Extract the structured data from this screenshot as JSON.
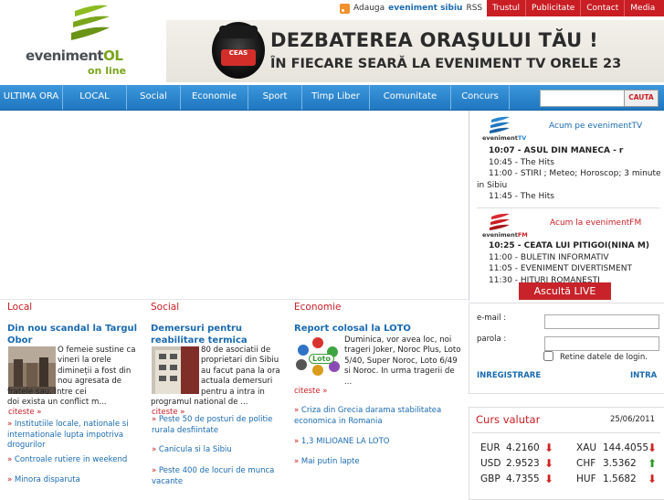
{
  "header": {
    "logo_word_a": "eveniment",
    "logo_word_b": "OL",
    "logo_sub": "on line",
    "rss_prefix": "Adauga",
    "rss_site": "eveniment sibiu",
    "rss_suffix": "RSS",
    "top_menu": [
      "Trustul",
      "Publicitate",
      "Contact",
      "Media"
    ],
    "banner_line1": "DEZBATEREA ORAŞULUI TĂU !",
    "banner_line2": "ÎN FIECARE SEARĂ LA EVENIMENT TV ORELE 23",
    "banner_badge": "CEAS"
  },
  "nav": {
    "items": [
      "ULTIMA ORA",
      "LOCAL",
      "Social",
      "Economie",
      "Sport",
      "Timp Liber",
      "Comunitate",
      "Concurs"
    ],
    "search_button": "CAUTA",
    "search_placeholder": ""
  },
  "tv": {
    "logo_a": "eveniment",
    "logo_b": "TV",
    "heading": "Acum pe evenimentTV",
    "now": "10:07 - ASUL DIN MANECA - r",
    "items": [
      "10:45 - The Hits",
      "11:00 - STIRI ; Meteo; Horoscop; 3 minute",
      "in Sibiu",
      "11:45 - The Hits"
    ]
  },
  "fm": {
    "logo_a": "eveniment",
    "logo_b": "FM",
    "heading": "Acum la evenimentFM",
    "now": "10:25 - CEATA LUI PITIGOI(NINA M)",
    "items": [
      "11:00 - BULETIN INFORMATIV",
      "11:05 - EVENIMENT DIVERTISMENT",
      "11:30 - HITURI ROMANESTI"
    ],
    "listen_button": "Ascultă LIVE"
  },
  "login": {
    "email_label": "e-mail :",
    "password_label": "parola :",
    "remember_label": "Retine datele de login.",
    "register": "INREGISTRARE",
    "enter": "INTRA"
  },
  "curs": {
    "title": "Curs valutar",
    "date": "25/06/2011",
    "rows": [
      {
        "code": "EUR",
        "value": "4.2160",
        "dir": "down",
        "code2": "XAU",
        "value2": "144.4055",
        "dir2": "down"
      },
      {
        "code": "USD",
        "value": "2.9523",
        "dir": "down",
        "code2": "CHF",
        "value2": "3.5362",
        "dir2": "up"
      },
      {
        "code": "GBP",
        "value": "4.7355",
        "dir": "down",
        "code2": "HUF",
        "value2": "1.5682",
        "dir2": "down"
      }
    ]
  },
  "columns": [
    {
      "category": "Local",
      "title_l1": "Din nou scandal la Targul",
      "title_l2": "Obor",
      "text": [
        "O femeie sustine ca",
        "vineri la orele",
        "dimineții a fost din",
        "nou agresata de",
        "fratele sau. Intre cei",
        "doi exista un conflict m..."
      ],
      "read_more": "citeste »",
      "links": [
        [
          "Institutiile locale, nationale si",
          "internationale lupta impotriva",
          "drogurilor"
        ],
        [
          "Controale rutiere in weekend"
        ],
        [
          "Minora disparuta"
        ]
      ]
    },
    {
      "category": "Social",
      "title_l1": "Demersuri pentru",
      "title_l2": "reabilitare termica",
      "text": [
        "80 de asociatii de",
        "proprietari din Sibiu",
        "au facut pana la ora",
        "actuala demersuri",
        "pentru a intra in",
        "programul national de ..."
      ],
      "read_more": "citeste »",
      "links": [
        [
          "Peste 50 de posturi de politie",
          "rurala desfiintate"
        ],
        [
          "Canicula si la Sibiu"
        ],
        [
          "Peste 400 de locuri de munca",
          "vacante"
        ]
      ]
    },
    {
      "category": "Economie",
      "title_l1": "Report colosal la LOTO",
      "title_l2": "",
      "text": [
        "Duminica, vor avea loc, noi",
        "trageri Joker, Noroc Plus, Loto",
        "5/40, Super Noroc, Loto 6/49",
        "si Noroc. In urma tragerii de",
        "..."
      ],
      "read_more": "citeste »",
      "loto_label": "Loto",
      "links": [
        [
          "Criza din Grecia darama stabilitatea",
          "economica in Romania"
        ],
        [
          "1,3 MILIOANE LA LOTO"
        ],
        [
          "Mai putin lapte"
        ]
      ]
    }
  ],
  "colors": {
    "accent_red": "#c81e24",
    "nav_blue": "#2a86cf",
    "link_blue": "#1a6ab0",
    "brand_green": "#7aa51b"
  }
}
